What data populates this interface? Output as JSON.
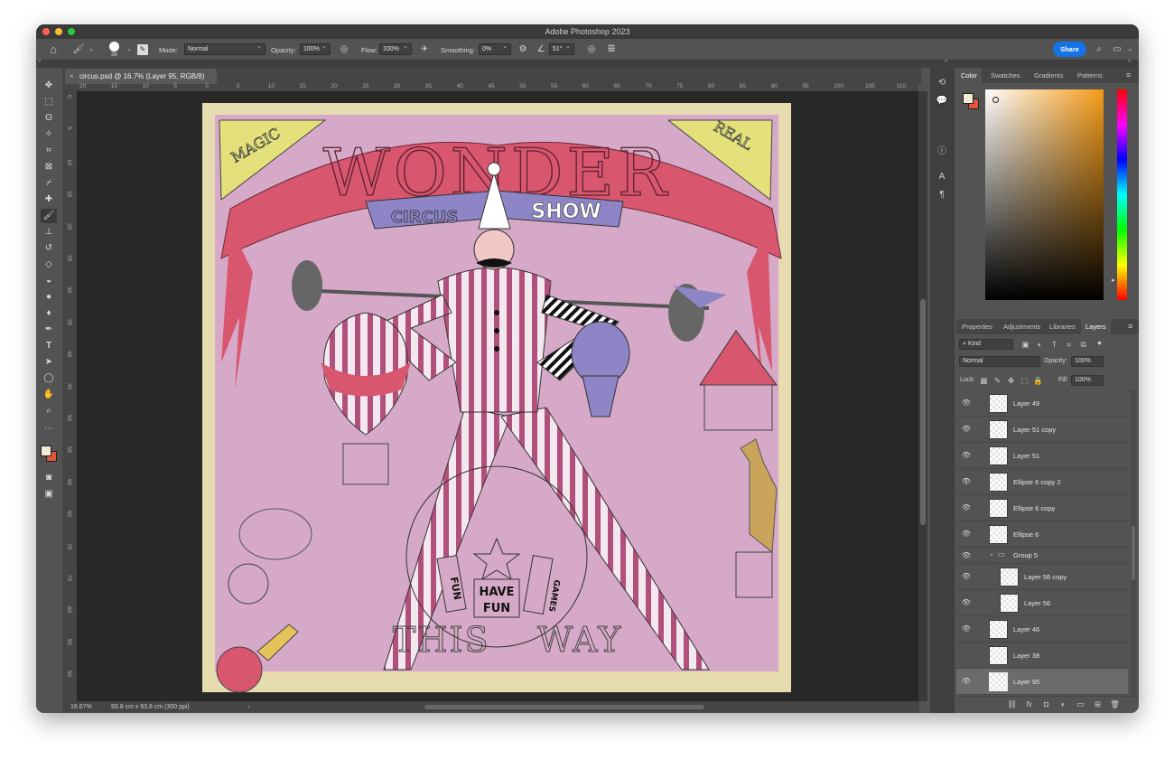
{
  "window": {
    "title": "Adobe Photoshop 2023"
  },
  "options_bar": {
    "home_icon": "home-icon",
    "brush_size": "39",
    "mode_label": "Mode:",
    "mode_value": "Normal",
    "opacity_label": "Opacity:",
    "opacity_value": "100%",
    "flow_label": "Flow:",
    "flow_value": "100%",
    "smoothing_label": "Smoothing:",
    "smoothing_value": "0%",
    "angle_value": "51°",
    "share_label": "Share"
  },
  "document": {
    "tab_title": "circus.psd @ 16.7% (Layer 95, RGB/8)",
    "zoom": "16.67%",
    "doc_size": "93.8 cm x 93.8 cm (300 ppi)"
  },
  "rulers": {
    "top_labels": [
      "20",
      "15",
      "10",
      "5",
      "0",
      "5",
      "10",
      "15",
      "20",
      "25",
      "30",
      "35",
      "40",
      "45",
      "50",
      "55",
      "60",
      "65",
      "70",
      "75",
      "80",
      "85",
      "90",
      "95",
      "100",
      "105",
      "110"
    ],
    "left_labels": [
      "0",
      "5",
      "1 0",
      "1 5",
      "2 0",
      "2 5",
      "3 0",
      "3 5",
      "4 0",
      "4 5",
      "5 0",
      "5 5",
      "6 0",
      "6 5",
      "7 0",
      "7 5",
      "8 0",
      "8 5",
      "9 0"
    ]
  },
  "artwork": {
    "corner_left": "MAGIC",
    "corner_right": "REAL",
    "title_word": "WONDER",
    "banner_left": "CIRCUS",
    "banner_right": "SHOW",
    "sign_left": "FUN",
    "sign_mid_1": "HAVE",
    "sign_mid_2": "FUN",
    "sign_right": "GAMES",
    "ground_left": "THIS",
    "ground_right": "WAY",
    "colors": {
      "background": "#d6a9c8",
      "border": "#e7dbb0",
      "banner": "#d8566e",
      "ribbon": "#8d85c6",
      "stripes": "#b2507c"
    }
  },
  "color_panel": {
    "tabs": [
      "Color",
      "Swatches",
      "Gradients",
      "Patterns"
    ],
    "active_tab": "Color",
    "foreground": "#f2ecd9",
    "background": "#e1553d",
    "hue_color": "#f59b17"
  },
  "layers_panel": {
    "tabs": [
      "Properties",
      "Adjustments",
      "Libraries",
      "Layers"
    ],
    "active_tab": "Layers",
    "filter_kind": "Kind",
    "blend_mode": "Normal",
    "opacity_label": "Opacity:",
    "opacity_value": "100%",
    "lock_label": "Lock:",
    "fill_label": "Fill:",
    "fill_value": "100%",
    "layers": [
      {
        "name": "Layer 49",
        "visible": true
      },
      {
        "name": "Layer 51 copy",
        "visible": true
      },
      {
        "name": "Layer 51",
        "visible": true
      },
      {
        "name": "Ellipse 6 copy 2",
        "visible": true
      },
      {
        "name": "Ellipse 6 copy",
        "visible": true
      },
      {
        "name": "Ellipse 6",
        "visible": true
      },
      {
        "name": "Group 5",
        "visible": true
      },
      {
        "name": "Layer 56 copy",
        "visible": true
      },
      {
        "name": "Layer 56",
        "visible": true
      },
      {
        "name": "Layer 46",
        "visible": true
      },
      {
        "name": "Layer 38",
        "visible": false
      },
      {
        "name": "Layer 95",
        "visible": true,
        "selected": true
      }
    ]
  }
}
